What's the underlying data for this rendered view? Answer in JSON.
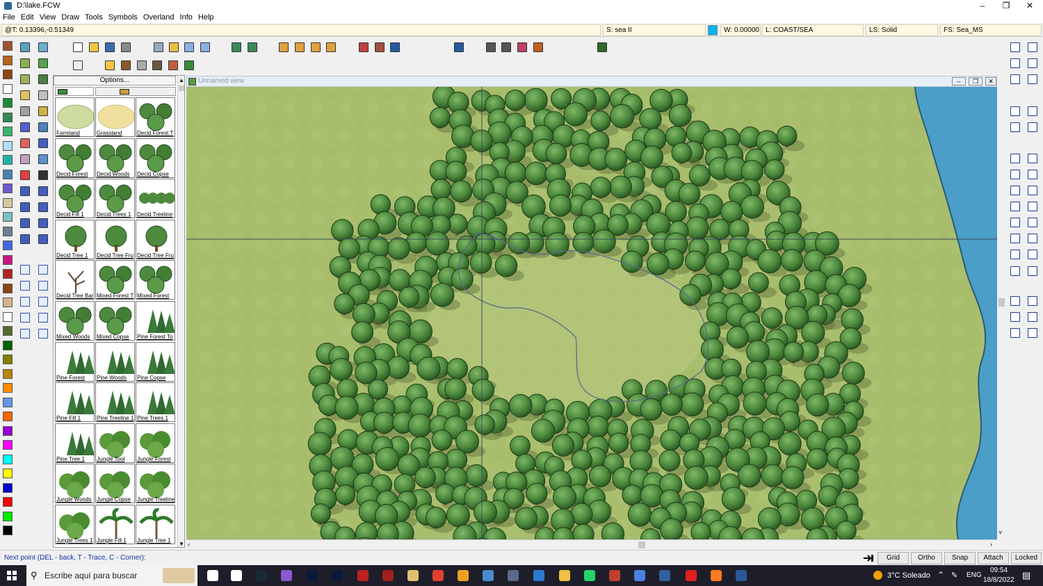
{
  "window": {
    "title": "D:\\lake.FCW"
  },
  "menu": [
    "File",
    "Edit",
    "View",
    "Draw",
    "Tools",
    "Symbols",
    "Overland",
    "Info",
    "Help"
  ],
  "status": {
    "coords": "@T: 0.13396,-0.51349",
    "sheet": "S: sea II",
    "width": "W: 0.00000",
    "layer": "L: COAST/SEA",
    "line_style": "LS: Solid",
    "fill_style": "FS: Sea_MS",
    "color_swatch": "#00b4f0"
  },
  "panel": {
    "options_label": "Options...",
    "symbols": [
      "Farmland",
      "Grassland",
      "Decid Forest T",
      "Decid Forest",
      "Decid Woods",
      "Decid Copse",
      "Decid Fill 1",
      "Decid Trees 1",
      "Decid Treeline",
      "Decid Tree 1",
      "Decid Tree Fru",
      "Decid Tree Fru",
      "Decid Tree Bar",
      "Mixed Forest T",
      "Mixed Forest",
      "Mixed Woods",
      "Mixed Copse",
      "Pine Forest To",
      "Pine Forest",
      "Pine Woods",
      "Pine Copse",
      "Pine Fill 1",
      "Pine Treeline 1",
      "Pine Trees 1",
      "Pine Tree 1",
      "Jungle Tool",
      "Jungle Forest",
      "Jungle Woods",
      "Jungle Copse",
      "Jungle Treeline",
      "Jungle Trees 1",
      "Jungle Fill 1",
      "Jungle Tree 1"
    ]
  },
  "view": {
    "title": "Unnamed view"
  },
  "command": {
    "prompt": "Next point (DEL - back, T - Trace, C - Corner):",
    "buttons": [
      "Grid",
      "Ortho",
      "Snap",
      "Attach",
      "Locked"
    ]
  },
  "taskbar": {
    "search_placeholder": "Escribe aquí para buscar",
    "weather": "3°C  Soleado",
    "lang": "ENG",
    "time": "09:54",
    "date": "18/8/2022"
  },
  "colors": {
    "grass": "#a9be6d",
    "water": "#4a9ec8",
    "tree_dark": "#2f6a2a",
    "tree_light": "#5e9c4c"
  },
  "palette": [
    "#a0522d",
    "#b5651d",
    "#8b4513",
    "#ffffff",
    "#1b8a3a",
    "#2e8b57",
    "#3cb371",
    "#b0e0f0",
    "#20b2aa",
    "#4682b4",
    "#6a5acd",
    "#d8c8a0",
    "#7fbfbf",
    "#708090",
    "#4169e1",
    "#c71585",
    "#b22222",
    "#8b4513",
    "#d2b48c",
    "#ffffff",
    "#556b2f",
    "#006400",
    "#808000",
    "#b8860b",
    "#ff8c00",
    "#6495ed",
    "#ff6600",
    "#9400d3",
    "#ff00ff",
    "#00ffff",
    "#ffff00",
    "#0000cd",
    "#ff0000",
    "#00ee00",
    "#000000"
  ]
}
